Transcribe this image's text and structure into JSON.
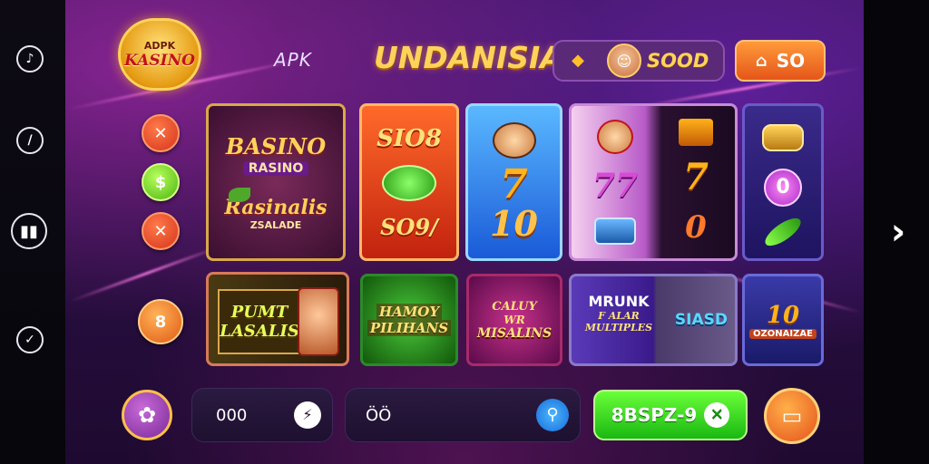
{
  "header": {
    "logo_top": "ADPK",
    "logo_main": "KASINO",
    "apk_label": "APK",
    "title": "UNDANISIA",
    "balance": "SOOD",
    "shop_label": "SO",
    "shop_icon": "house-icon",
    "balance_icon": "diamond-icon"
  },
  "rail_left": {
    "icons": [
      "music-note-icon",
      "clock-icon",
      "bar-chart-icon",
      "check-icon"
    ]
  },
  "side_buttons": {
    "b1": "✕",
    "b2": "$",
    "b3": "✕",
    "b4": "8"
  },
  "games": {
    "g1": {
      "title": "BASINO",
      "sub": "RASINO",
      "line2": "Rasinalis",
      "line3": "ZSALADE"
    },
    "g2": {
      "top": "SIO8",
      "bottom": "SO9/"
    },
    "g3": {
      "s1": "7",
      "s2": "10"
    },
    "g4": {
      "n1": "77",
      "s7": "7",
      "z": "0"
    },
    "g5": {
      "orb": "0"
    },
    "g6": {
      "a": "PUMT",
      "b": "LASALIS"
    },
    "g7": {
      "a": "HAMOY",
      "b": "PILIHANS"
    },
    "g8": {
      "a": "CALUY",
      "b": "WR",
      "c": "MISALINS"
    },
    "g9": {
      "a": "MRUNK",
      "b": "F ALAR",
      "c": "MULTIPLES",
      "right": "SIASD"
    },
    "g10": {
      "a": "10",
      "b": "OZONAIZAE"
    }
  },
  "bottom": {
    "bet_value": "000",
    "bet_btn": "⚡",
    "search_value": "ÖÖ",
    "search_icon": "search-icon",
    "spin_label": "8BSPZ-9",
    "spin_x": "✕"
  },
  "nav": {
    "next_icon": "chevron-right-icon"
  }
}
